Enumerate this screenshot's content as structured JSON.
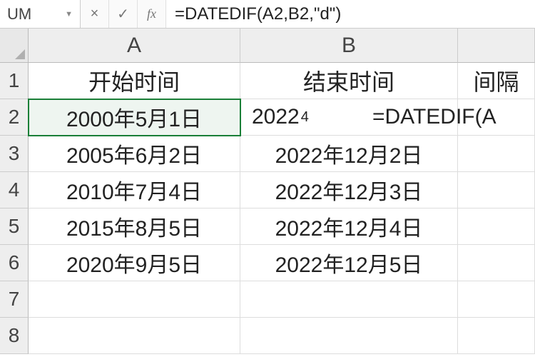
{
  "name_box": "UM",
  "formula_bar": {
    "cancel": "×",
    "confirm": "✓",
    "fx": "fx",
    "formula": "=DATEDIF(A2,B2,\"d\")"
  },
  "columns": {
    "a": "A",
    "b": "B",
    "c": ""
  },
  "rows": [
    "1",
    "2",
    "3",
    "4",
    "5",
    "6",
    "7",
    "8"
  ],
  "headers": {
    "a": "开始时间",
    "b": "结束时间",
    "c": "间隔"
  },
  "data": [
    {
      "a": "2000年5月1日",
      "b_partial": "2022",
      "b_marker": "4",
      "c_overflow": "=DATEDIF(A"
    },
    {
      "a": "2005年6月2日",
      "b": "2022年12月2日"
    },
    {
      "a": "2010年7月4日",
      "b": "2022年12月3日"
    },
    {
      "a": "2015年8月5日",
      "b": "2022年12月4日"
    },
    {
      "a": "2020年9月5日",
      "b": "2022年12月5日"
    }
  ],
  "chart_data": {
    "type": "table",
    "columns": [
      "开始时间",
      "结束时间",
      "间隔"
    ],
    "rows": [
      [
        "2000年5月1日",
        "2022年...",
        "=DATEDIF(A2,B2,\"d\")"
      ],
      [
        "2005年6月2日",
        "2022年12月2日",
        ""
      ],
      [
        "2010年7月4日",
        "2022年12月3日",
        ""
      ],
      [
        "2015年8月5日",
        "2022年12月4日",
        ""
      ],
      [
        "2020年9月5日",
        "2022年12月5日",
        ""
      ]
    ]
  }
}
